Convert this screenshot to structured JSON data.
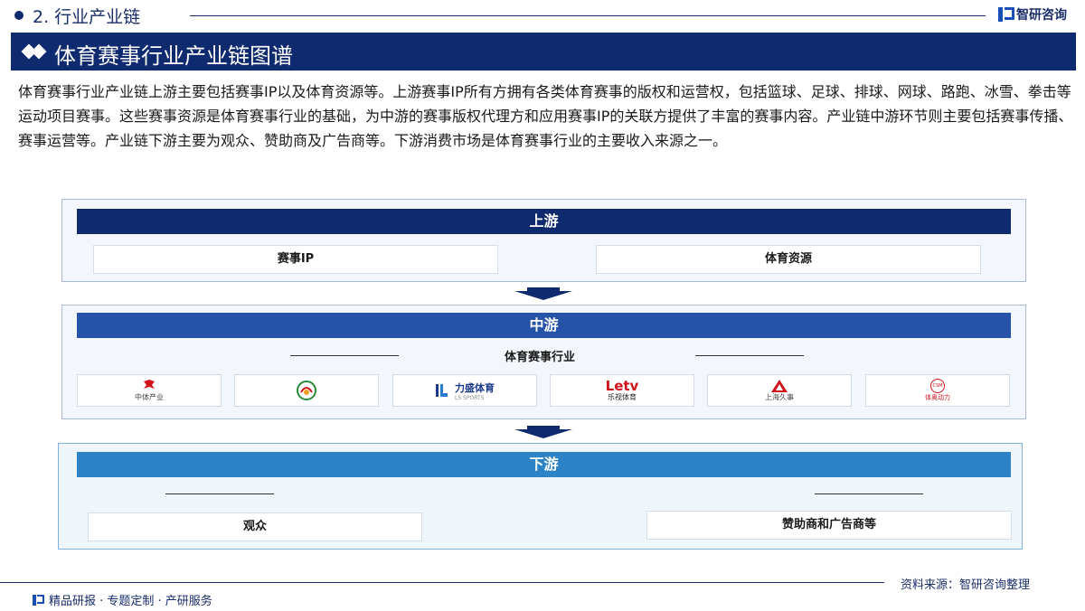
{
  "header": {
    "section": "2. 行业产业链",
    "brand": "智研咨询"
  },
  "title": "体育赛事行业产业链图谱",
  "description": "体育赛事行业产业链上游主要包括赛事IP以及体育资源等。上游赛事IP所有方拥有各类体育赛事的版权和运营权，包括篮球、足球、排球、网球、路跑、冰雪、拳击等运动项目赛事。这些赛事资源是体育赛事行业的基础，为中游的赛事版权代理方和应用赛事IP的关联方提供了丰富的赛事内容。产业链中游环节则主要包括赛事传播、赛事运营等。产业链下游主要为观众、赞助商及广告商等。下游消费市场是体育赛事行业的主要收入来源之一。",
  "upstream": {
    "label": "上游",
    "items": [
      "赛事IP",
      "体育资源"
    ]
  },
  "midstream": {
    "label": "中游",
    "sub_label": "体育赛事行业",
    "logos": [
      {
        "icon": "zhongti-logo-icon",
        "text": "中体产业"
      },
      {
        "icon": "emblem-logo-icon",
        "text": ""
      },
      {
        "icon": "lisheng-logo-icon",
        "text": "力盛体育",
        "sub": "LS SPORTS"
      },
      {
        "icon": "letv-logo-icon",
        "text": "Letv",
        "sub": "乐视体育"
      },
      {
        "icon": "shanghai-jiushi-logo-icon",
        "text": "上海久事"
      },
      {
        "icon": "csm-logo-icon",
        "text": "CSM",
        "sub": "体奥动力"
      }
    ]
  },
  "downstream": {
    "label": "下游",
    "items": [
      "观众",
      "赞助商和广告商等"
    ]
  },
  "footer": {
    "source": "资料来源：智研咨询整理",
    "tagline": "精品研报 · 专题定制 · 产研服务"
  },
  "colors": {
    "navy": "#0f2a6e",
    "mid_blue": "#2553a8",
    "light_blue": "#2e83c6"
  }
}
